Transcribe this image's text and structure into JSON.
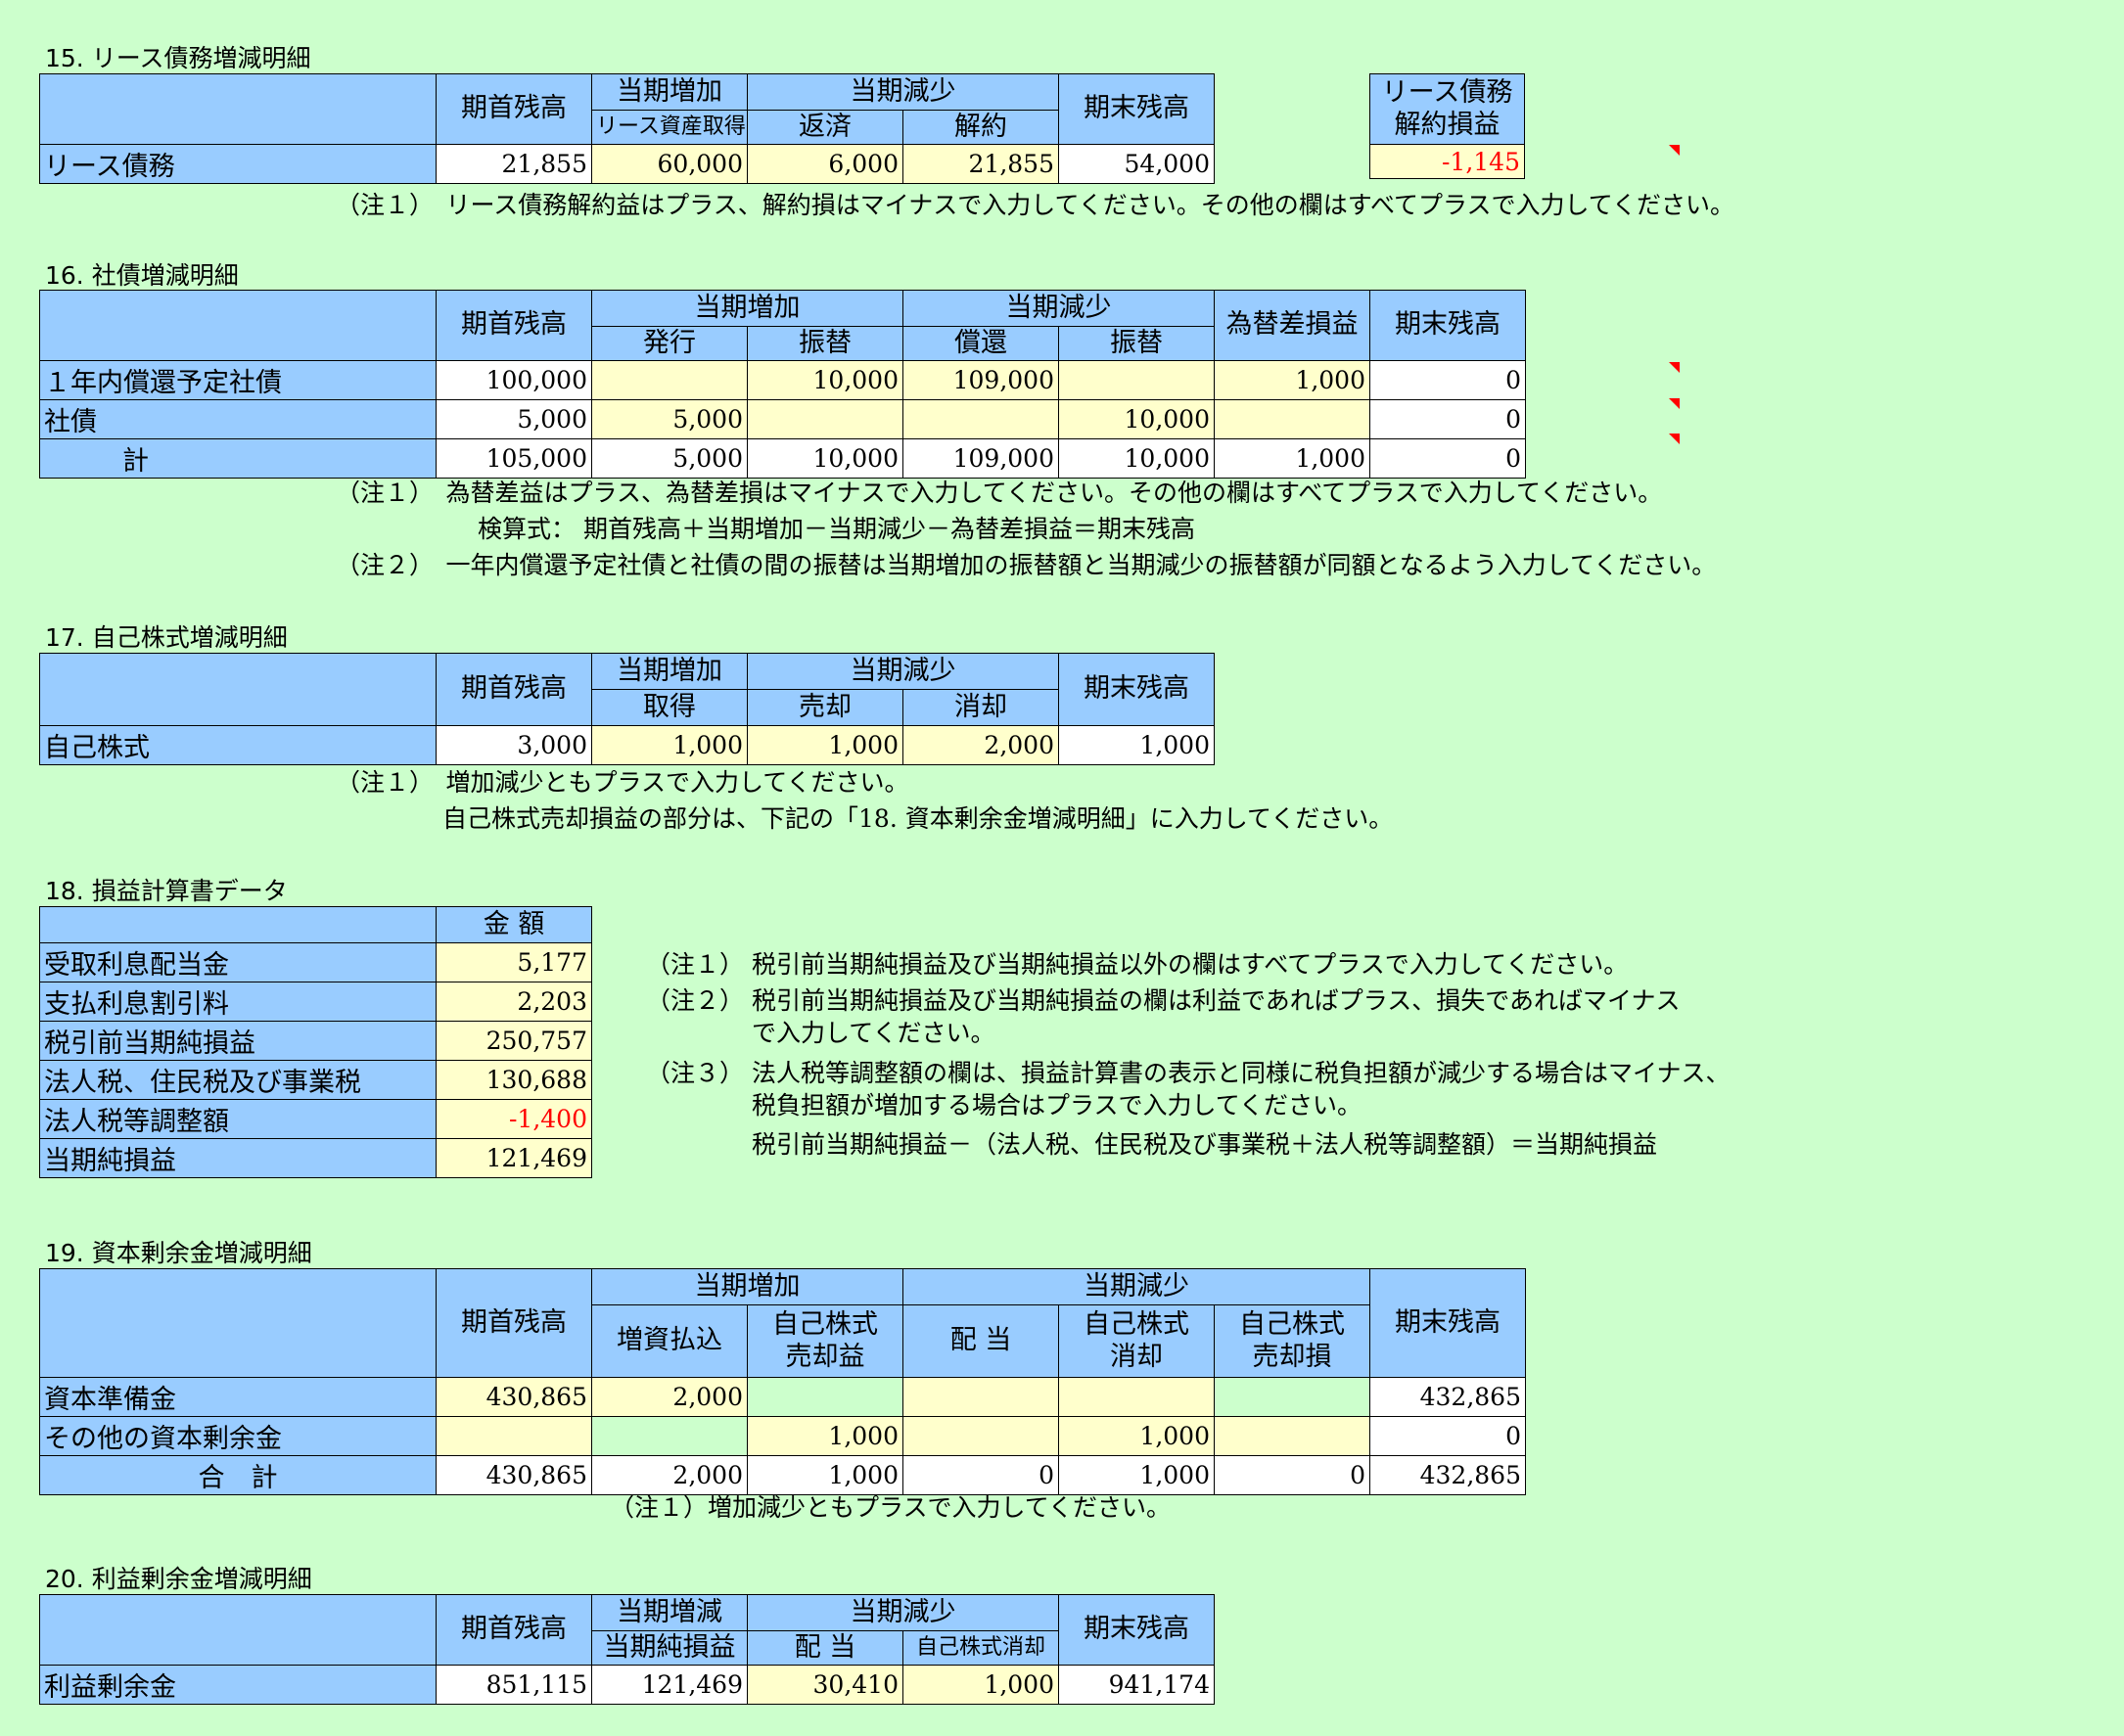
{
  "s15": {
    "title": "15. リース債務増減明細",
    "h_begin": "期首残高",
    "h_inc": "当期増加",
    "h_inc_sub": "リース資産取得",
    "h_dec": "当期減少",
    "h_dec_repay": "返済",
    "h_dec_cancel": "解約",
    "h_end": "期末残高",
    "h_side1": "リース債務",
    "h_side2": "解約損益",
    "row_label": "リース債務",
    "v_begin": "21,855",
    "v_inc": "60,000",
    "v_repay": "6,000",
    "v_cancel": "21,855",
    "v_end": "54,000",
    "v_side": "-1,145",
    "note1": "（注１）　リース債務解約益はプラス、解約損はマイナスで入力してください。その他の欄はすべてプラスで入力してください。"
  },
  "s16": {
    "title": "16. 社債増減明細",
    "h_begin": "期首残高",
    "h_inc": "当期増加",
    "h_inc_issue": "発行",
    "h_inc_transfer": "振替",
    "h_dec": "当期減少",
    "h_dec_redeem": "償還",
    "h_dec_transfer": "振替",
    "h_fx": "為替差損益",
    "h_end": "期末残高",
    "rows": [
      {
        "label": "１年内償還予定社債",
        "begin": "100,000",
        "issue": "",
        "inc_transfer": "10,000",
        "redeem": "109,000",
        "dec_transfer": "",
        "fx": "1,000",
        "end": "0"
      },
      {
        "label": "社債",
        "begin": "5,000",
        "issue": "5,000",
        "inc_transfer": "",
        "redeem": "",
        "dec_transfer": "10,000",
        "fx": "",
        "end": "0"
      },
      {
        "label": "計",
        "begin": "105,000",
        "issue": "5,000",
        "inc_transfer": "10,000",
        "redeem": "109,000",
        "dec_transfer": "10,000",
        "fx": "1,000",
        "end": "0"
      }
    ],
    "note1": "（注１）　為替差益はプラス、為替差損はマイナスで入力してください。その他の欄はすべてプラスで入力してください。",
    "note1b": "検算式：  期首残高＋当期増加－当期減少－為替差損益＝期末残高",
    "note2": "（注２）　一年内償還予定社債と社債の間の振替は当期増加の振替額と当期減少の振替額が同額となるよう入力してください。"
  },
  "s17": {
    "title": "17. 自己株式増減明細",
    "h_begin": "期首残高",
    "h_inc": "当期増加",
    "h_inc_sub": "取得",
    "h_dec": "当期減少",
    "h_dec_sell": "売却",
    "h_dec_retire": "消却",
    "h_end": "期末残高",
    "row_label": "自己株式",
    "v_begin": "3,000",
    "v_inc": "1,000",
    "v_sell": "1,000",
    "v_retire": "2,000",
    "v_end": "1,000",
    "note1": "（注１）　増加減少ともプラスで入力してください。",
    "note1b": "自己株式売却損益の部分は、下記の「18.  資本剰余金増減明細」に入力してください。"
  },
  "s18": {
    "title": "18. 損益計算書データ",
    "h_amount": "金 額",
    "rows": [
      {
        "label": "受取利息配当金",
        "value": "5,177"
      },
      {
        "label": "支払利息割引料",
        "value": "2,203"
      },
      {
        "label": "税引前当期純損益",
        "value": "250,757"
      },
      {
        "label": "法人税、住民税及び事業税",
        "value": "130,688"
      },
      {
        "label": "法人税等調整額",
        "value": "-1,400"
      },
      {
        "label": "当期純損益",
        "value": "121,469"
      }
    ],
    "note1_tag": "（注１）",
    "note1": "税引前当期純損益及び当期純損益以外の欄はすべてプラスで入力してください。",
    "note2_tag": "（注２）",
    "note2": "税引前当期純損益及び当期純損益の欄は利益であればプラス、損失であればマイナス",
    "note2b": "で入力してください。",
    "note3_tag": "（注３）",
    "note3": "法人税等調整額の欄は、損益計算書の表示と同様に税負担額が減少する場合はマイナス、",
    "note3b": "税負担額が増加する場合はプラスで入力してください。",
    "note3c": "税引前当期純損益－（法人税、住民税及び事業税＋法人税等調整額）＝当期純損益"
  },
  "s19": {
    "title": "19. 資本剰余金増減明細",
    "h_begin": "期首残高",
    "h_inc": "当期増加",
    "h_inc_cap": "増資払込",
    "h_inc_gain1": "自己株式",
    "h_inc_gain2": "売却益",
    "h_dec": "当期減少",
    "h_dec_div": "配 当",
    "h_dec_ret1": "自己株式",
    "h_dec_ret2": "消却",
    "h_dec_loss1": "自己株式",
    "h_dec_loss2": "売却損",
    "h_end": "期末残高",
    "rows": [
      {
        "label": "資本準備金",
        "begin": "430,865",
        "cap": "2,000",
        "gain": "",
        "div": "",
        "ret": "",
        "loss": "",
        "end": "432,865"
      },
      {
        "label": "その他の資本剰余金",
        "begin": "",
        "cap": "",
        "gain": "1,000",
        "div": "",
        "ret": "1,000",
        "loss": "",
        "end": "0"
      },
      {
        "label": "合　計",
        "begin": "430,865",
        "cap": "2,000",
        "gain": "1,000",
        "div": "0",
        "ret": "1,000",
        "loss": "0",
        "end": "432,865"
      }
    ],
    "note1": "（注１）増加減少ともプラスで入力してください。"
  },
  "s20": {
    "title": "20. 利益剰余金増減明細",
    "h_begin": "期首残高",
    "h_inc": "当期増減",
    "h_inc_sub": "当期純損益",
    "h_dec": "当期減少",
    "h_dec_div": "配 当",
    "h_dec_ret": "自己株式消却",
    "h_end": "期末残高",
    "row_label": "利益剰余金",
    "v_begin": "851,115",
    "v_inc": "121,469",
    "v_div": "30,410",
    "v_ret": "1,000",
    "v_end": "941,174"
  }
}
